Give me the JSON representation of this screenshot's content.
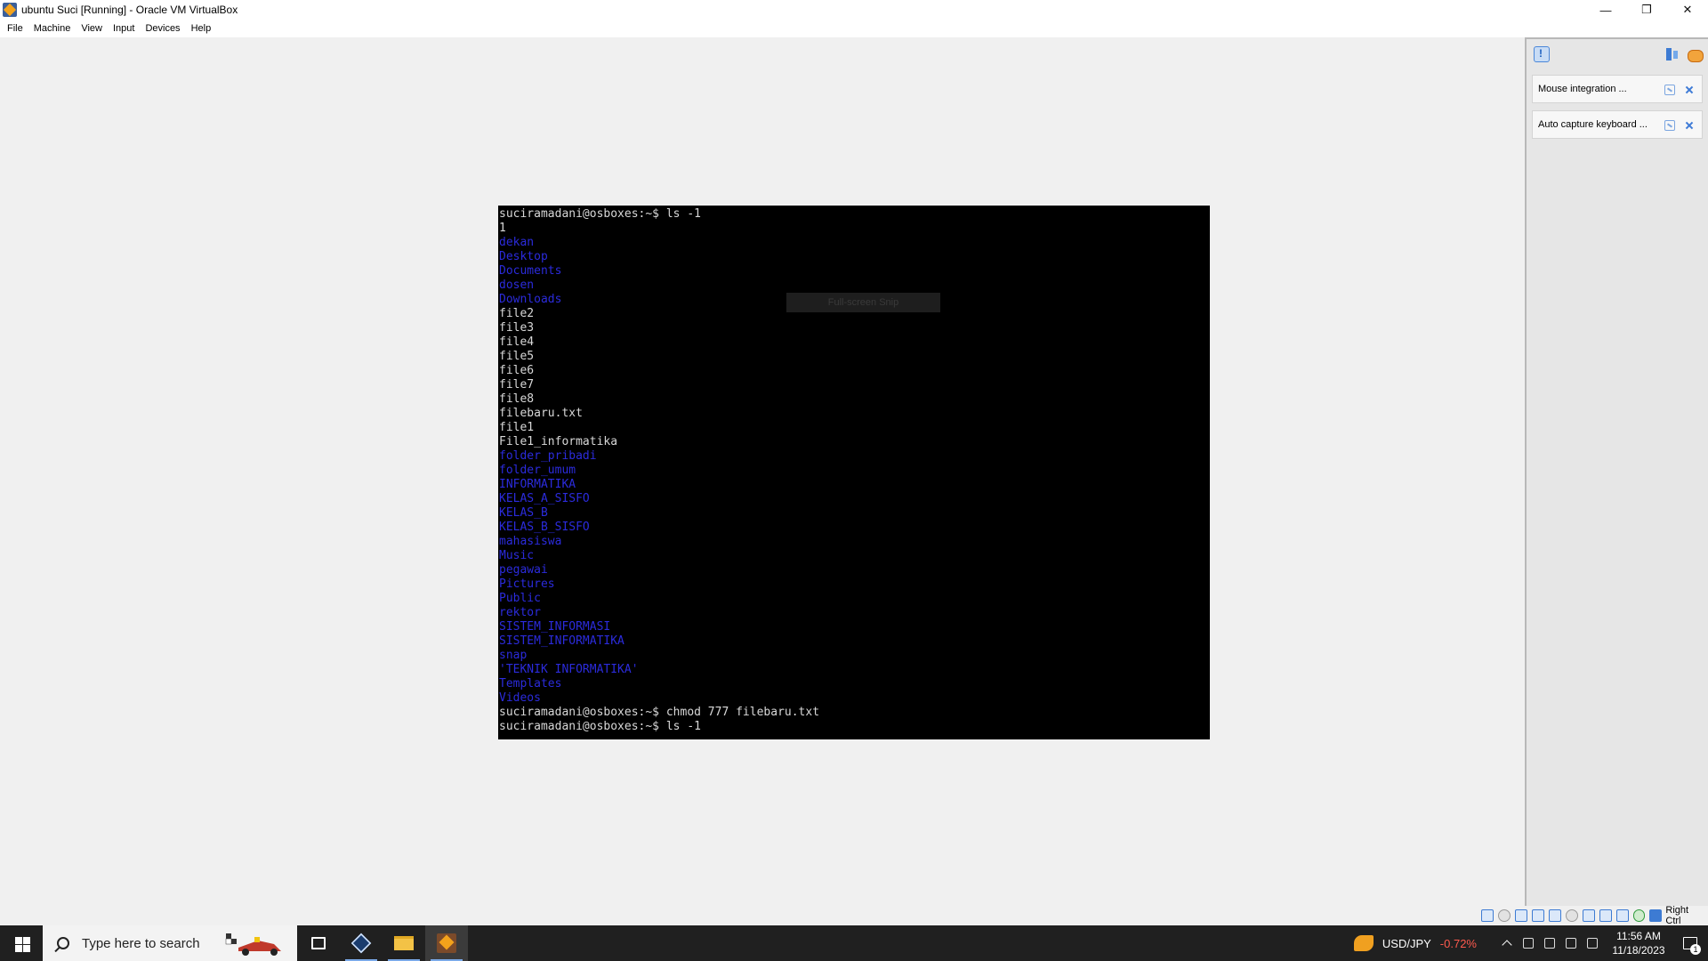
{
  "window": {
    "title": "ubuntu Suci [Running] - Oracle VM VirtualBox",
    "minimize": "—",
    "restore": "❐",
    "close": "✕"
  },
  "menu": [
    "File",
    "Machine",
    "View",
    "Input",
    "Devices",
    "Help"
  ],
  "terminal": {
    "lines": [
      {
        "text": "suciramadani@osboxes:~$ ls -1",
        "kind": "plain"
      },
      {
        "text": "1",
        "kind": "plain"
      },
      {
        "text": "dekan",
        "kind": "dir"
      },
      {
        "text": "Desktop",
        "kind": "dir"
      },
      {
        "text": "Documents",
        "kind": "dir"
      },
      {
        "text": "dosen",
        "kind": "dir"
      },
      {
        "text": "Downloads",
        "kind": "dir"
      },
      {
        "text": "file2",
        "kind": "plain"
      },
      {
        "text": "file3",
        "kind": "plain"
      },
      {
        "text": "file4",
        "kind": "plain"
      },
      {
        "text": "file5",
        "kind": "plain"
      },
      {
        "text": "file6",
        "kind": "plain"
      },
      {
        "text": "file7",
        "kind": "plain"
      },
      {
        "text": "file8",
        "kind": "plain"
      },
      {
        "text": "filebaru.txt",
        "kind": "plain"
      },
      {
        "text": "file1",
        "kind": "plain"
      },
      {
        "text": "File1_informatika",
        "kind": "plain"
      },
      {
        "text": "folder_pribadi",
        "kind": "dir"
      },
      {
        "text": "folder_umum",
        "kind": "dir"
      },
      {
        "text": "INFORMATIKA",
        "kind": "dir"
      },
      {
        "text": "KELAS_A_SISFO",
        "kind": "dir"
      },
      {
        "text": "KELAS_B",
        "kind": "dir"
      },
      {
        "text": "KELAS_B_SISFO",
        "kind": "dir"
      },
      {
        "text": "mahasiswa",
        "kind": "dir"
      },
      {
        "text": "Music",
        "kind": "dir"
      },
      {
        "text": "pegawai",
        "kind": "dir"
      },
      {
        "text": "Pictures",
        "kind": "dir"
      },
      {
        "text": "Public",
        "kind": "dir"
      },
      {
        "text": "rektor",
        "kind": "dir"
      },
      {
        "text": "SISTEM_INFORMASI",
        "kind": "dir"
      },
      {
        "text": "SISTEM_INFORMATIKA",
        "kind": "dir"
      },
      {
        "text": "snap",
        "kind": "dir"
      },
      {
        "text": "'TEKNIK INFORMATIKA'",
        "kind": "dir"
      },
      {
        "text": "Templates",
        "kind": "dir"
      },
      {
        "text": "Videos",
        "kind": "dir"
      },
      {
        "text": "suciramadani@osboxes:~$ chmod 777 filebaru.txt",
        "kind": "plain"
      },
      {
        "text": "suciramadani@osboxes:~$ ls -1",
        "kind": "plain"
      }
    ],
    "overlay": "Full-screen Snip"
  },
  "notifications": {
    "items": [
      {
        "text": "Mouse integration ..."
      },
      {
        "text": "Auto capture keyboard ..."
      }
    ]
  },
  "statusbar": {
    "host_key": "Right Ctrl"
  },
  "taskbar": {
    "search_placeholder": "Type here to search",
    "currency_pair": "USD/JPY",
    "currency_change": "-0.72%",
    "time": "11:56 AM",
    "date": "11/18/2023",
    "notification_count": "1"
  },
  "colors": {
    "terminal_bg": "#000000",
    "terminal_fg": "#d8d8d8",
    "terminal_dir": "#2b2bdc",
    "fx_negative": "#ff5a4e"
  }
}
